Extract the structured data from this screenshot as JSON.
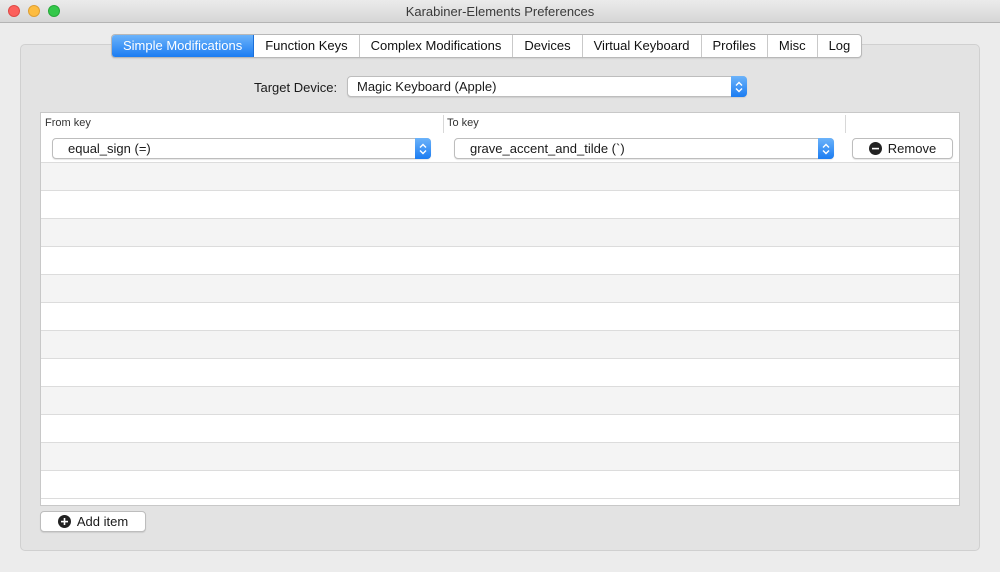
{
  "window": {
    "title": "Karabiner-Elements Preferences"
  },
  "tabs": [
    {
      "label": "Simple Modifications",
      "active": true
    },
    {
      "label": "Function Keys",
      "active": false
    },
    {
      "label": "Complex Modifications",
      "active": false
    },
    {
      "label": "Devices",
      "active": false
    },
    {
      "label": "Virtual Keyboard",
      "active": false
    },
    {
      "label": "Profiles",
      "active": false
    },
    {
      "label": "Misc",
      "active": false
    },
    {
      "label": "Log",
      "active": false
    }
  ],
  "target_device": {
    "label": "Target Device:",
    "selected": "Magic Keyboard (Apple)"
  },
  "table": {
    "columns": {
      "from": "From key",
      "to": "To key"
    },
    "rows": [
      {
        "from_key": "equal_sign (=)",
        "to_key": "grave_accent_and_tilde (`)",
        "remove_label": "Remove"
      }
    ]
  },
  "footer": {
    "add_item_label": "Add item"
  },
  "icons": {
    "remove": "minus-circle-icon",
    "add": "plus-circle-icon",
    "popup": "up-down-chevron-icon"
  },
  "colors": {
    "accent": "#1b7cf2",
    "window_bg": "#ececec",
    "close": "#fc605c",
    "minimize": "#fdbc40",
    "maximize": "#34c84a"
  }
}
